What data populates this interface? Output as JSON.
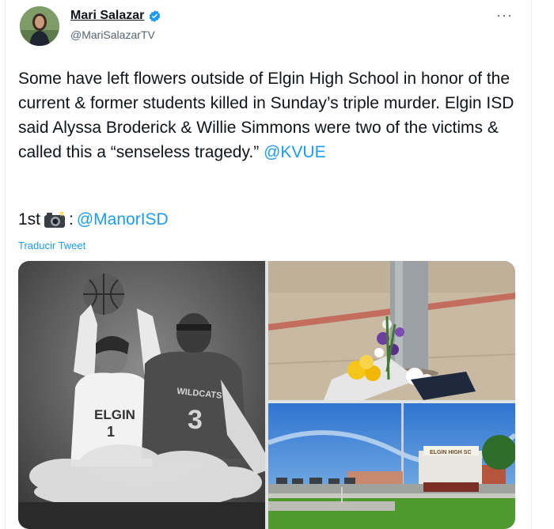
{
  "author": {
    "name": "Mari Salazar",
    "handle": "@MariSalazarTV",
    "verified": true
  },
  "tweet": {
    "text_before": "Some have left flowers outside of Elgin High School in honor of the current & former students killed in Sunday’s triple murder. Elgin ISD said Alyssa Broderick & Willie Simmons were two of the victims & called this a “senseless tragedy.” ",
    "mention": "@KVUE",
    "credit_prefix": "1st",
    "credit_sep": ":",
    "credit_mention": "@ManorISD",
    "translate_label": "Traducir Tweet"
  },
  "media": {
    "left_jersey_1": "ELGIN",
    "left_jersey_1_number": "1",
    "left_jersey_2": "WILDCATS",
    "left_jersey_2_number": "3",
    "school_sign": "ELGIN HIGH SC"
  },
  "colors": {
    "link": "#1d9bf0",
    "verified": "#1d9bf0",
    "text": "#0f1419",
    "secondary": "#536471"
  }
}
